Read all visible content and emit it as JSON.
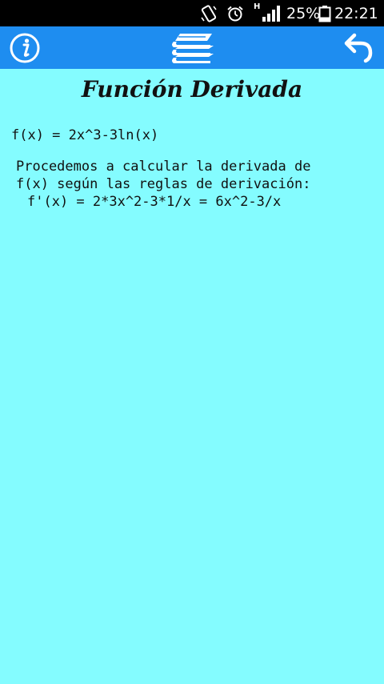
{
  "status_bar": {
    "network_letter": "H",
    "battery": "25%",
    "time": "22:21"
  },
  "toolbar": {
    "left_icon": "info-icon",
    "center_icon": "books-stack-icon",
    "right_icon": "back-arrow-icon",
    "color": "#1e8df0"
  },
  "content": {
    "title": "Función Derivada",
    "function_line": "f(x) = 2x^3-3ln(x)",
    "explanation_line1": "Procedemos a calcular la derivada de",
    "explanation_line2": "f(x) según las reglas de derivación:",
    "derivative_line": "f'(x) = 2*3x^2-3*1/x = 6x^2-3/x",
    "background": "#84fcff"
  }
}
